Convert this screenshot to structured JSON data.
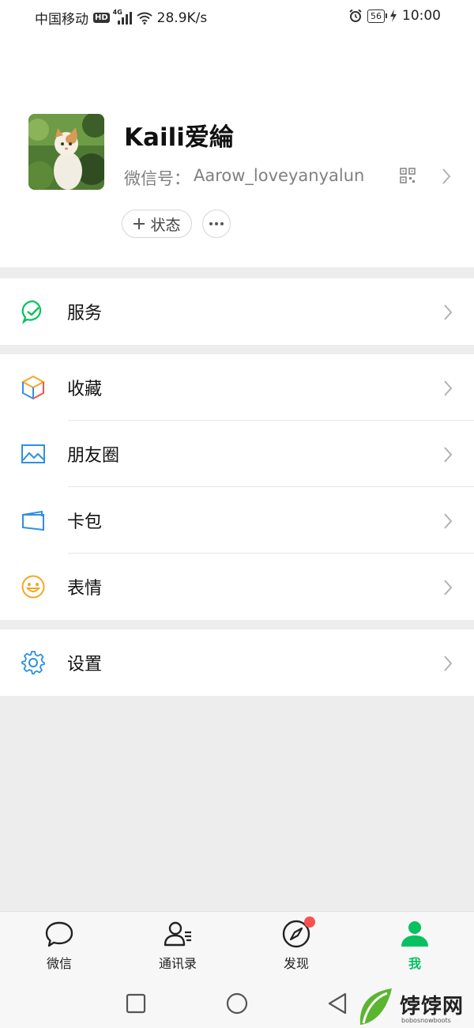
{
  "status_bar": {
    "carrier": "中国移动",
    "hd": "HD",
    "network": "4G",
    "speed": "28.9K/s",
    "battery": "56",
    "time": "10:00"
  },
  "profile": {
    "nickname": "Kaili爱綸",
    "wxid_label": "微信号：",
    "wxid": "Aarow_loveyanyalun",
    "status_button": "状态",
    "more_icon": "ellipsis-icon"
  },
  "menu": {
    "services": [
      {
        "label": "服务",
        "icon": "wechat-pay-icon"
      }
    ],
    "main": [
      {
        "label": "收藏",
        "icon": "favorites-cube-icon"
      },
      {
        "label": "朋友圈",
        "icon": "moments-photo-icon"
      },
      {
        "label": "卡包",
        "icon": "card-wallet-icon"
      },
      {
        "label": "表情",
        "icon": "sticker-smile-icon"
      }
    ],
    "settings": [
      {
        "label": "设置",
        "icon": "gear-icon"
      }
    ]
  },
  "tabs": [
    {
      "label": "微信",
      "icon": "chat-bubble-icon",
      "active": false
    },
    {
      "label": "通讯录",
      "icon": "contacts-icon",
      "active": false
    },
    {
      "label": "发现",
      "icon": "compass-icon",
      "active": false,
      "badge": true
    },
    {
      "label": "我",
      "icon": "person-icon",
      "active": true
    }
  ],
  "watermark": {
    "brand": "饽饽网",
    "url": "bobosnowboots"
  },
  "colors": {
    "accent_green": "#07c160",
    "badge_red": "#fa5151",
    "background": "#ededed"
  }
}
